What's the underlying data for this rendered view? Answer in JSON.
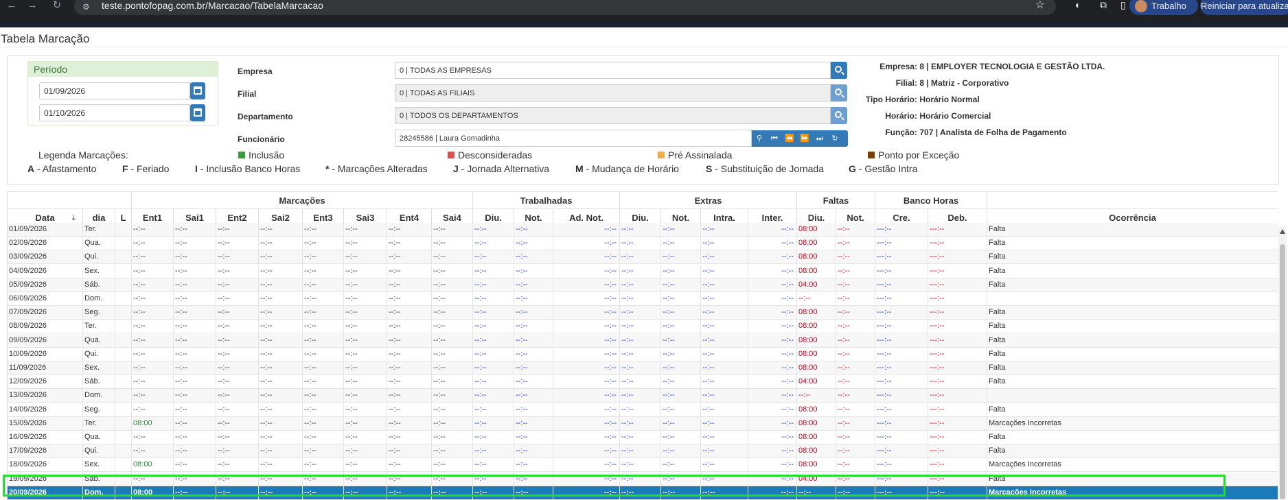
{
  "browser": {
    "url": "teste.pontofopag.com.br/Marcacao/TabelaMarcacao",
    "profile_label": "Trabalho",
    "update_label": "Reiniciar para atualizar"
  },
  "page": {
    "title": "Tabela Marcação"
  },
  "periodo": {
    "label": "Período",
    "start": "01/09/2026",
    "end": "01/10/2026"
  },
  "filters": {
    "empresa_label": "Empresa",
    "empresa_value": "0 | TODAS AS EMPRESAS",
    "filial_label": "Filial",
    "filial_value": "0 | TODAS AS FILIAIS",
    "departamento_label": "Departamento",
    "departamento_value": "0 | TODOS OS DEPARTAMENTOS",
    "funcionario_label": "Funcionário",
    "funcionario_value": "28245586 | Laura Gomadinha"
  },
  "info": {
    "empresa_k": "Empresa:",
    "empresa_v": "8 | EMPLOYER TECNOLOGIA E GESTÃO LTDA.",
    "filial_k": "Filial:",
    "filial_v": "8 | Matriz - Corporativo",
    "tipo_k": "Tipo Horário:",
    "tipo_v": "Horário Normal",
    "horario_k": "Horário:",
    "horario_v": "Horário Comercial",
    "funcao_k": "Função:",
    "funcao_v": "707 | Analista de Folha de Pagamento"
  },
  "legend": {
    "title": "Legenda Marcações:",
    "items": [
      {
        "label": "Inclusão",
        "color": "#3c9b3c"
      },
      {
        "label": "Desconsideradas",
        "color": "#d9534f"
      },
      {
        "label": "Pré Assinalada",
        "color": "#f0ad4e"
      },
      {
        "label": "Ponto por Exceção",
        "color": "#7b3f00"
      }
    ],
    "codes": [
      {
        "k": "A",
        "v": " - Afastamento"
      },
      {
        "k": "F",
        "v": " - Feriado"
      },
      {
        "k": "I",
        "v": " - Inclusão Banco Horas"
      },
      {
        "k": "*",
        "v": " - Marcações Alteradas"
      },
      {
        "k": "J",
        "v": " - Jornada Alternativa"
      },
      {
        "k": "M",
        "v": " - Mudança de Horário"
      },
      {
        "k": "S",
        "v": " - Substituição de Jornada"
      },
      {
        "k": "G",
        "v": " - Gestão Intra"
      }
    ]
  },
  "table": {
    "groups": [
      "Marcações",
      "Trabalhadas",
      "Extras",
      "Faltas",
      "Banco Horas"
    ],
    "columns": [
      "Data",
      "dia",
      "L",
      "Ent1",
      "Sai1",
      "Ent2",
      "Sai2",
      "Ent3",
      "Sai3",
      "Ent4",
      "Sai4",
      "Diu.",
      "Not.",
      "Ad. Not.",
      "Diu.",
      "Not.",
      "Intra.",
      "Inter.",
      "Diu.",
      "Not.",
      "Cre.",
      "Deb.",
      "Ocorrência"
    ],
    "empty_time": "--:--",
    "empty_bank": "---:--",
    "rows": [
      {
        "data": "01/09/2026",
        "dia": "Ter.",
        "ent1": "--:--",
        "falta": "08:00",
        "oc": "Falta"
      },
      {
        "data": "02/09/2026",
        "dia": "Qua.",
        "ent1": "--:--",
        "falta": "08:00",
        "oc": "Falta"
      },
      {
        "data": "03/09/2026",
        "dia": "Qui.",
        "ent1": "--:--",
        "falta": "08:00",
        "oc": "Falta"
      },
      {
        "data": "04/09/2026",
        "dia": "Sex.",
        "ent1": "--:--",
        "falta": "08:00",
        "oc": "Falta"
      },
      {
        "data": "05/09/2026",
        "dia": "Sáb.",
        "ent1": "--:--",
        "falta": "04:00",
        "oc": "Falta"
      },
      {
        "data": "06/09/2026",
        "dia": "Dom.",
        "ent1": "--:--",
        "falta": "--:--",
        "oc": ""
      },
      {
        "data": "07/09/2026",
        "dia": "Seg.",
        "ent1": "--:--",
        "falta": "08:00",
        "oc": "Falta"
      },
      {
        "data": "08/09/2026",
        "dia": "Ter.",
        "ent1": "--:--",
        "falta": "08:00",
        "oc": "Falta"
      },
      {
        "data": "09/09/2026",
        "dia": "Qua.",
        "ent1": "--:--",
        "falta": "08:00",
        "oc": "Falta"
      },
      {
        "data": "10/09/2026",
        "dia": "Qui.",
        "ent1": "--:--",
        "falta": "08:00",
        "oc": "Falta"
      },
      {
        "data": "11/09/2026",
        "dia": "Sex.",
        "ent1": "--:--",
        "falta": "08:00",
        "oc": "Falta"
      },
      {
        "data": "12/09/2026",
        "dia": "Sáb.",
        "ent1": "--:--",
        "falta": "04:00",
        "oc": "Falta"
      },
      {
        "data": "13/09/2026",
        "dia": "Dom.",
        "ent1": "--:--",
        "falta": "--:--",
        "oc": ""
      },
      {
        "data": "14/09/2026",
        "dia": "Seg.",
        "ent1": "--:--",
        "falta": "08:00",
        "oc": "Falta"
      },
      {
        "data": "15/09/2026",
        "dia": "Ter.",
        "ent1": "08:00",
        "falta": "08:00",
        "oc": "Marcações Incorretas"
      },
      {
        "data": "16/09/2026",
        "dia": "Qua.",
        "ent1": "--:--",
        "falta": "08:00",
        "oc": "Falta"
      },
      {
        "data": "17/09/2026",
        "dia": "Qui.",
        "ent1": "--:--",
        "falta": "08:00",
        "oc": "Falta"
      },
      {
        "data": "18/09/2026",
        "dia": "Sex.",
        "ent1": "08:00",
        "falta": "08:00",
        "oc": "Marcações Incorretas"
      },
      {
        "data": "19/09/2026",
        "dia": "Sáb.",
        "ent1": "--:--",
        "falta": "04:00",
        "oc": "Falta"
      },
      {
        "data": "20/09/2026",
        "dia": "Dom.",
        "ent1": "08:00",
        "falta": "--:--",
        "oc": "Marcações Incorretas",
        "selected": true
      }
    ]
  }
}
